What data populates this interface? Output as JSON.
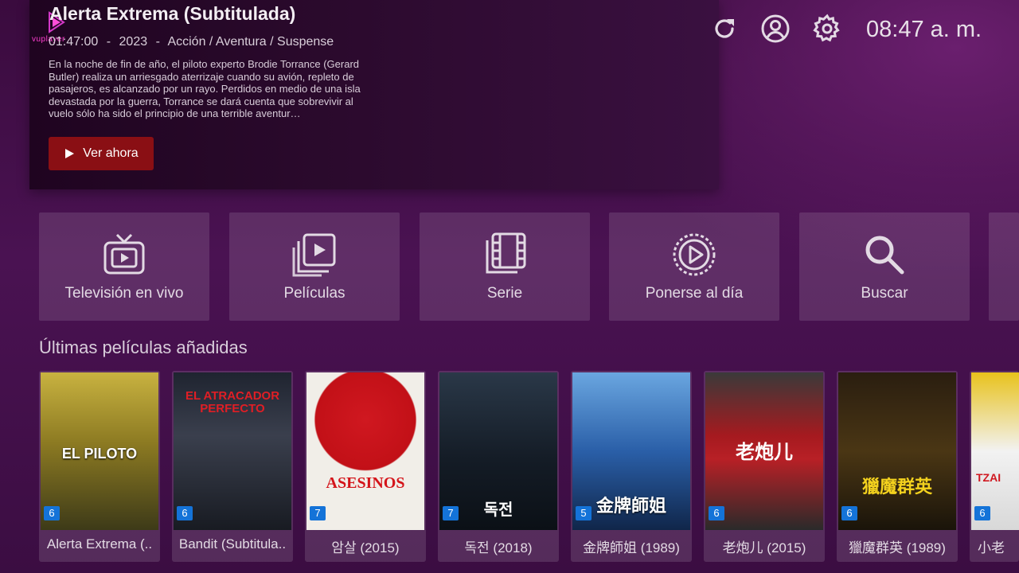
{
  "brand": {
    "logo_text": "vuplayer"
  },
  "hero": {
    "title": "Alerta Extrema (Subtitulada)",
    "duration": "01:47:00",
    "year": "2023",
    "genres": "Acción / Aventura / Suspense",
    "separator": "-",
    "description": "En la noche de fin de año, el piloto experto Brodie Torrance (Gerard Butler) realiza un arriesgado aterrizaje cuando su avión, repleto de pasajeros, es alcanzado por un rayo. Perdidos en medio de una isla devastada por la guerra, Torrance se dará cuenta que sobrevivir al vuelo sólo ha sido el principio de una terrible aventur…",
    "watch_label": "Ver ahora"
  },
  "topbar": {
    "icons": [
      "refresh-icon",
      "account-icon",
      "settings-icon"
    ],
    "time": "08:47 a. m."
  },
  "categories": [
    {
      "label": "Televisión en vivo",
      "icon": "tv-icon"
    },
    {
      "label": "Películas",
      "icon": "movies-icon"
    },
    {
      "label": "Serie",
      "icon": "series-icon"
    },
    {
      "label": "Ponerse al día",
      "icon": "catchup-icon"
    },
    {
      "label": "Buscar",
      "icon": "search-icon"
    }
  ],
  "section_title": "Últimas películas añadidas",
  "movies": [
    {
      "caption": "Alerta Extrema (..",
      "badge": "6",
      "poster_text": "EL PILOTO",
      "poster_color": "#b39a2a"
    },
    {
      "caption": "Bandit (Subtitula..",
      "badge": "6",
      "poster_text": "EL ATRACADOR PERFECTO",
      "poster_color": "#2b2f3a"
    },
    {
      "caption": "암살 (2015)",
      "badge": "7",
      "poster_text": "ASESINOS",
      "poster_color": "#c9141c"
    },
    {
      "caption": "독전 (2018)",
      "badge": "7",
      "poster_text": "독전",
      "poster_color": "#1e2a38"
    },
    {
      "caption": "金牌師姐 (1989)",
      "badge": "5",
      "poster_text": "金牌師姐",
      "poster_color": "#2a5fa8"
    },
    {
      "caption": "老炮儿 (2015)",
      "badge": "6",
      "poster_text": "老炮儿",
      "poster_color": "#a51a1f"
    },
    {
      "caption": "獵魔群英 (1989)",
      "badge": "6",
      "poster_text": "獵魔群英",
      "poster_color": "#3a2a12"
    },
    {
      "caption": "小老",
      "badge": "6",
      "poster_text": "TZAI",
      "poster_color": "#e8c21c"
    }
  ]
}
